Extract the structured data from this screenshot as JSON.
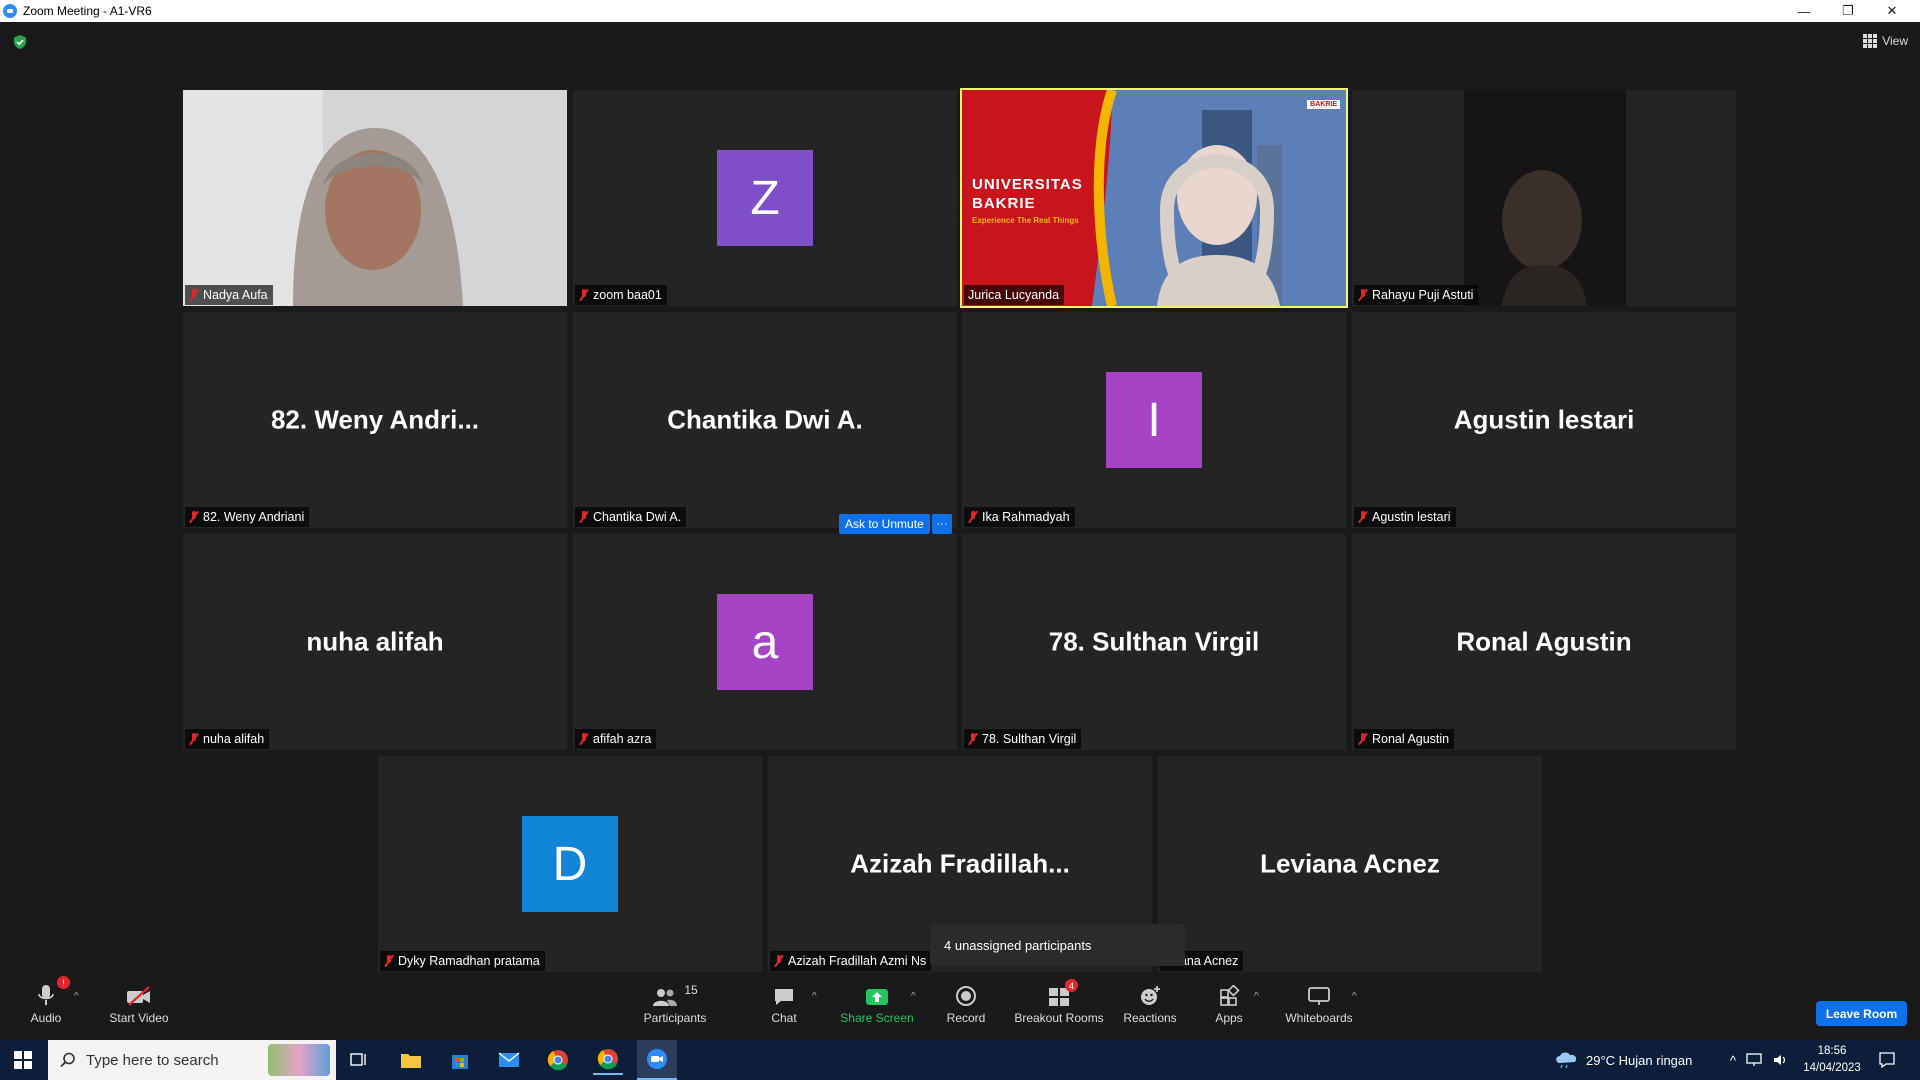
{
  "window": {
    "title": "Zoom Meeting - A1-VR6"
  },
  "top": {
    "view_label": "View"
  },
  "tiles": [
    {
      "name": "Nadya Aufa",
      "type": "video"
    },
    {
      "name": "zoom baa01",
      "type": "avatar",
      "letter": "Z",
      "color": "#7f4fc7"
    },
    {
      "name": "Jurica Lucyanda",
      "type": "video-presenter"
    },
    {
      "name": "Rahayu Puji Astuti",
      "type": "video"
    },
    {
      "name": "82. Weny Andriani",
      "type": "name",
      "display": "82.  Weny  Andri..."
    },
    {
      "name": "Chantika Dwi A.",
      "type": "name",
      "display": "Chantika Dwi A."
    },
    {
      "name": "Ika Rahmadyah",
      "type": "avatar",
      "letter": "I",
      "color": "#a642c4"
    },
    {
      "name": "Agustin lestari",
      "type": "name",
      "display": "Agustin lestari"
    },
    {
      "name": "nuha alifah",
      "type": "name",
      "display": "nuha alifah"
    },
    {
      "name": "afifah azra",
      "type": "avatar",
      "letter": "a",
      "color": "#a642c4"
    },
    {
      "name": "78. Sulthan Virgil",
      "type": "name",
      "display": "78. Sulthan Virgil"
    },
    {
      "name": "Ronal Agustin",
      "type": "name",
      "display": "Ronal Agustin"
    },
    {
      "name": "Dyky Ramadhan pratama",
      "type": "avatar",
      "letter": "D",
      "color": "#1185d4"
    },
    {
      "name": "Azizah Fradillah Azmi Ns",
      "type": "name",
      "display": "Azizah  Fradillah..."
    },
    {
      "name": "eviana Acnez",
      "type": "name",
      "display": "Leviana Acnez"
    }
  ],
  "presenter_slide": {
    "line1": "UNIVERSITAS",
    "line2": "BAKRIE",
    "tagline": "Experience The Real Things",
    "logo": "BAKRIE"
  },
  "overlay": {
    "ask_unmute": "Ask to Unmute",
    "more": "···",
    "tooltip": "4 unassigned participants"
  },
  "toolbar": {
    "audio": "Audio",
    "audio_badge": "!",
    "start_video": "Start Video",
    "participants": "Participants",
    "participants_count": "15",
    "chat": "Chat",
    "share_screen": "Share Screen",
    "record": "Record",
    "breakout_rooms": "Breakout Rooms",
    "breakout_badge": "4",
    "reactions": "Reactions",
    "apps": "Apps",
    "whiteboards": "Whiteboards",
    "leave_room": "Leave Room",
    "share_color": "#22c55e"
  },
  "taskbar": {
    "search_placeholder": "Type here to search",
    "weather": "29°C  Hujan ringan",
    "time": "18:56",
    "date": "14/04/2023"
  }
}
